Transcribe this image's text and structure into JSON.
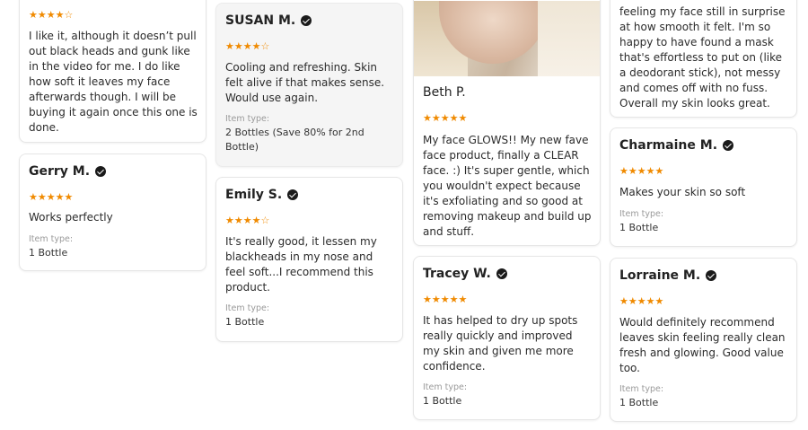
{
  "accent": {
    "star": "#f08a00",
    "check": "#1a1a1a"
  },
  "reviews": [
    {
      "body": "I like it,  although it doesn’t pull out black heads and gunk like in the video for me. I do like how soft it leaves my face afterwards though. I will be buying it again once this one is done.",
      "rating": 4
    },
    {
      "name": "Gerry M.",
      "rating": 5,
      "body": "Works perfectly",
      "item_type_label": "Item type:",
      "item_type": "1 Bottle"
    },
    {
      "name": "SUSAN M.",
      "rating": 4,
      "body": "Cooling and refreshing. Skin felt alive if that makes sense. Would use again.",
      "item_type_label": "Item type:",
      "item_type": "2 Bottles (Save 80% for 2nd Bottle)"
    },
    {
      "name": "Emily S.",
      "rating": 4,
      "body": "It's really good,  it lessen my blackheads in my nose and feel soft...I recommend this product.",
      "item_type_label": "Item type:",
      "item_type": "1 Bottle"
    },
    {
      "name": "Beth P.",
      "rating": 5,
      "body": "My face GLOWS!! My new fave face product, finally a CLEAR face. :) It's super gentle, which you wouldn't expect because it's exfoliating and so good at removing makeup and build up and stuff."
    },
    {
      "name": "Tracey W.",
      "rating": 5,
      "body": "It has helped to dry up spots really quickly and improved my skin and given me more confidence.",
      "item_type_label": "Item type:",
      "item_type": "1 Bottle"
    },
    {
      "body": "feeling my face still in surprise at how smooth it felt. I'm so happy to have found a mask that's effortless to put on (like a deodorant stick), not messy and comes off with no fuss. Overall my skin looks great."
    },
    {
      "name": "Charmaine M.",
      "rating": 5,
      "body": "Makes your skin so soft",
      "item_type_label": "Item type:",
      "item_type": "1 Bottle"
    },
    {
      "name": "Lorraine M.",
      "rating": 5,
      "body": "Would definitely recommend leaves skin feeling really clean fresh and glowing. Good value too.",
      "item_type_label": "Item type:",
      "item_type": "1 Bottle"
    }
  ]
}
